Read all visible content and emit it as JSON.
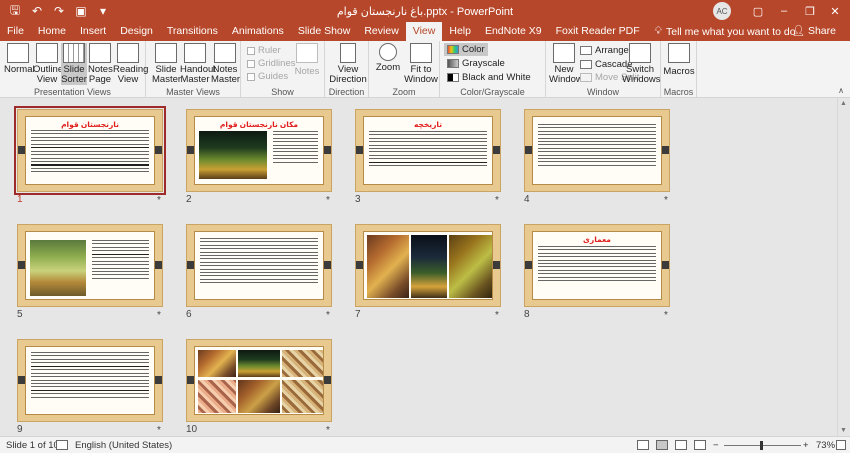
{
  "titlebar": {
    "title": "باغ نارنجستان قوام.pptx - PowerPoint",
    "avatar": "AC",
    "qat_icons": [
      "save-icon",
      "undo-icon",
      "redo-icon",
      "present-icon",
      "customize-qat-icon"
    ]
  },
  "tabs": [
    "File",
    "Home",
    "Insert",
    "Design",
    "Transitions",
    "Animations",
    "Slide Show",
    "Review",
    "View",
    "Help",
    "EndNote X9",
    "Foxit Reader PDF"
  ],
  "active_tab": "View",
  "tell_me": "Tell me what you want to do",
  "share": "Share",
  "ribbon": {
    "presentation_views": {
      "label": "Presentation Views",
      "buttons": [
        "Normal",
        "Outline View",
        "Slide Sorter",
        "Notes Page",
        "Reading View"
      ]
    },
    "master_views": {
      "label": "Master Views",
      "buttons": [
        "Slide Master",
        "Handout Master",
        "Notes Master"
      ]
    },
    "show": {
      "label": "Show",
      "checks": [
        "Ruler",
        "Gridlines",
        "Guides"
      ],
      "notes": "Notes"
    },
    "direction": {
      "label": "Direction",
      "button": "View Direction"
    },
    "zoom": {
      "label": "Zoom",
      "buttons": [
        "Zoom",
        "Fit to Window"
      ]
    },
    "color": {
      "label": "Color/Grayscale",
      "items": [
        "Color",
        "Grayscale",
        "Black and White"
      ]
    },
    "window": {
      "label": "Window",
      "new_window": "New Window",
      "items": [
        "Arrange All",
        "Cascade",
        "Move Split"
      ],
      "switch": "Switch Windows"
    },
    "macros": {
      "label": "Macros",
      "button": "Macros"
    }
  },
  "slides": [
    {
      "num": "1",
      "title": "نارنجستان قوام",
      "star": "*"
    },
    {
      "num": "2",
      "title": "مکان نارنجستان قوام",
      "star": "*"
    },
    {
      "num": "3",
      "title": "تاریخچه",
      "star": "*"
    },
    {
      "num": "4",
      "title": "",
      "star": "*"
    },
    {
      "num": "5",
      "title": "",
      "star": "*"
    },
    {
      "num": "6",
      "title": "",
      "star": "*"
    },
    {
      "num": "7",
      "title": "",
      "star": "*"
    },
    {
      "num": "8",
      "title": "معماری",
      "star": "*"
    },
    {
      "num": "9",
      "title": "",
      "star": "*"
    },
    {
      "num": "10",
      "title": "",
      "star": "*"
    }
  ],
  "status": {
    "slide_info": "Slide 1 of 10",
    "language": "English (United States)",
    "zoom_minus": "−",
    "zoom_plus": "+",
    "zoom": "73%",
    "zoom_fraction": 0.73
  }
}
